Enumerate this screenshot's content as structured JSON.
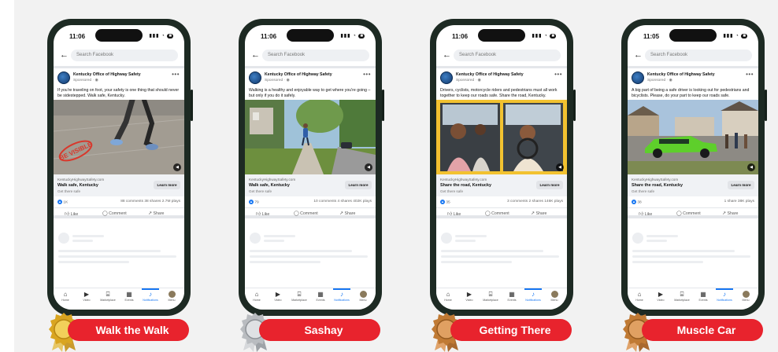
{
  "status_time": [
    "11:06",
    "11:06",
    "11:06",
    "11:05"
  ],
  "search_placeholder": "Search Facebook",
  "page_name": "Kentucky Office of Highway Safety",
  "sponsored": "Sponsored · ",
  "link_domain": "KentuckyHighwaySafety.com",
  "link_subtitle": "Get there safe",
  "learn_more": "Learn more",
  "actions": {
    "like": "Like",
    "comment": "Comment",
    "share": "Share"
  },
  "tabs": [
    "Home",
    "Video",
    "Marketplace",
    "Events",
    "Notifications",
    "Menu"
  ],
  "posts": [
    {
      "caption": "If you're traveling on foot, your safety is one thing that should never be sidestepped. Walk safe, Kentucky.",
      "link_title": "Walk safe, Kentucky",
      "likes": "1K",
      "comments": "88 comments",
      "shares": "38 shares",
      "plays": "2.7M plays",
      "award": "Walk the Walk",
      "medal": "gold-medal"
    },
    {
      "caption": "Walking is a healthy and enjoyable way to get where you're going – but only if you do it safely.",
      "link_title": "Walk safe, Kentucky",
      "likes": "79",
      "comments": "10 comments",
      "shares": "4 shares",
      "plays": "402K plays",
      "award": "Sashay",
      "medal": "silver-medal"
    },
    {
      "caption": "Drivers, cyclists, motorcycle riders and pedestrians must all work together to keep our roads safe. Share the road, Kentucky.",
      "link_title": "Share the road, Kentucky",
      "likes": "35",
      "comments": "3 comments",
      "shares": "2 shares",
      "plays": "146K plays",
      "award": "Getting There",
      "medal": "bronze-medal"
    },
    {
      "caption": "A big part of being a safe driver is looking out for pedestrians and bicyclists. Please, do your part to keep our roads safe.",
      "link_title": "Share the road, Kentucky",
      "likes": "38",
      "comments": "",
      "shares": "1 share",
      "plays": "38K plays",
      "award": "Muscle Car",
      "medal": "bronze-medal"
    }
  ],
  "colors": {
    "award_red": "#e8232d",
    "gold": "#d9a521",
    "silver": "#b9bcc0",
    "bronze": "#c07a34",
    "facebook_blue": "#1877f2"
  }
}
